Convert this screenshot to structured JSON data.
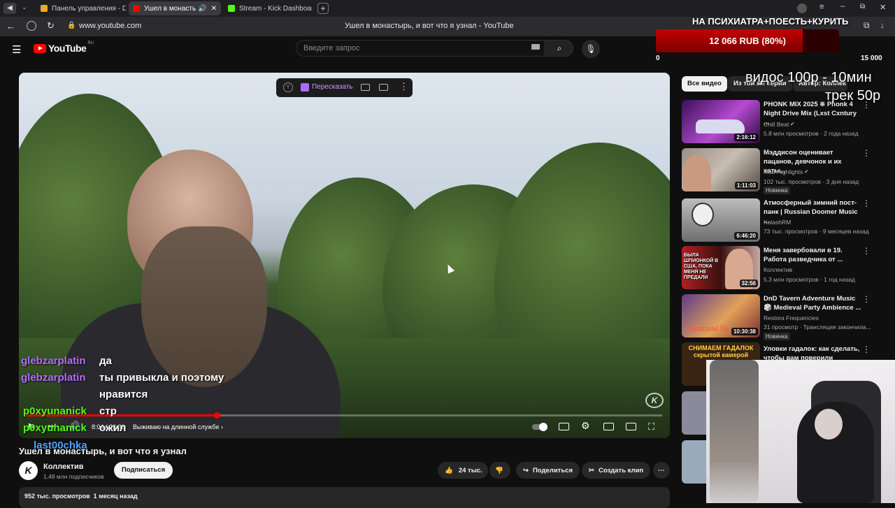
{
  "browser": {
    "tabs": [
      {
        "label": "Панель управления - Don",
        "favicon_color": "#f5a623"
      },
      {
        "label": "Ушел в монастырь, ...",
        "favicon_color": "#ff0000"
      },
      {
        "label": "Stream - Kick Dashboard",
        "favicon_color": "#53fc18"
      }
    ],
    "url": "www.youtube.com",
    "page_title": "Ушел в монастырь, и вот что я узнал - YouTube"
  },
  "youtube": {
    "logo": "YouTube",
    "region": "RU",
    "search_placeholder": "Введите запрос",
    "accent": "#ff0000"
  },
  "video": {
    "overlay_toolbar": {
      "retell_label": "Пересказать"
    },
    "chapter": "Выживаю на длинной службе",
    "time": "8:04 / 26:30",
    "progress": 0.3
  },
  "chat": [
    {
      "name": "glebzarplatin",
      "name_color": "#b46cff",
      "message": "да"
    },
    {
      "name": "glebzarplatin",
      "name_color": "#b46cff",
      "message": "ты привыкла и поэтому"
    },
    {
      "name": "",
      "name_color": "#b46cff",
      "message": "нравится"
    },
    {
      "name": "p0xyunanick",
      "name_color": "#53fc18",
      "message": "стр"
    },
    {
      "name": "p0xyunanick",
      "name_color": "#53fc18",
      "message": "ожил"
    },
    {
      "name": "last00chka",
      "name_color": "#4fa3ff",
      "message": ""
    }
  ],
  "title": "Ушел в монастырь, и вот что я узнал",
  "channel": {
    "name": "Коллектив",
    "subscribers": "1,48 млн подписчиков",
    "subscribe_label": "Подписаться"
  },
  "actions": {
    "likes": "24 тыс.",
    "share": "Поделиться",
    "clip": "Создать клип"
  },
  "stats": "952 тыс. просмотров  1 месяц назад",
  "filters": [
    "Все видео",
    "Из той же серии",
    "Автор: Коллек"
  ],
  "recommendations": [
    {
      "title": "PHONK MIX 2025 ※ Phonk 4 Night Drive Mix (Lxst Cxntury ...",
      "channel": "Chill Beat",
      "meta": "5,8 млн просмотров · 2 года назад",
      "duration": "2:16:12",
      "badge": ""
    },
    {
      "title": "Мэддисон оценивает пацанов, девчонок и их хаты...",
      "channel": "Mad Highlights",
      "meta": "102 тыс. просмотров · 3 дня назад",
      "duration": "1:11:03",
      "badge": "Новинка"
    },
    {
      "title": "Атмосферный зимний пост-панк | Russian Doomer Music ...",
      "channel": "KalashRM",
      "meta": "73 тыс. просмотров · 9 месяцев назад",
      "duration": "6:46:20",
      "badge": ""
    },
    {
      "title": "Меня завербовали в 19. Работа разведчика от ...",
      "channel": "Коллектив",
      "meta": "5,3 млн просмотров · 1 год назад",
      "duration": "32:56",
      "badge": ""
    },
    {
      "title": "DnD Tavern Adventure Music 🎲 Medieval Party Ambience ...",
      "channel": "Restora Frequencies",
      "meta": "31 просмотр · Трансляция закончила...",
      "duration": "10:30:38",
      "badge": "Новинка"
    },
    {
      "title": "Уловки гадалок: как сделать, чтобы вам поверили",
      "channel": "",
      "meta": "",
      "duration": "",
      "badge": ""
    }
  ],
  "thumb_texts": {
    "t4": "БЫЛА ШПИОНКОЙ В США, ПОКА МЕНЯ НЕ ПРЕДАЛИ",
    "t5": "Festival Ta",
    "t6": "СНИМАЕМ ГАДАЛОК скрытой камерой"
  },
  "stream_overlay": {
    "goal_title": "НА ПСИХИАТРА+ПОЕСТЬ+КУРИТЬ",
    "goal_amount": "12 066 RUB (80%)",
    "goal_progress": 0.8,
    "goal_min": "0",
    "goal_max": "15 000",
    "price_line1": "видос 100р - 10мин",
    "price_line2": "трек 50р"
  }
}
